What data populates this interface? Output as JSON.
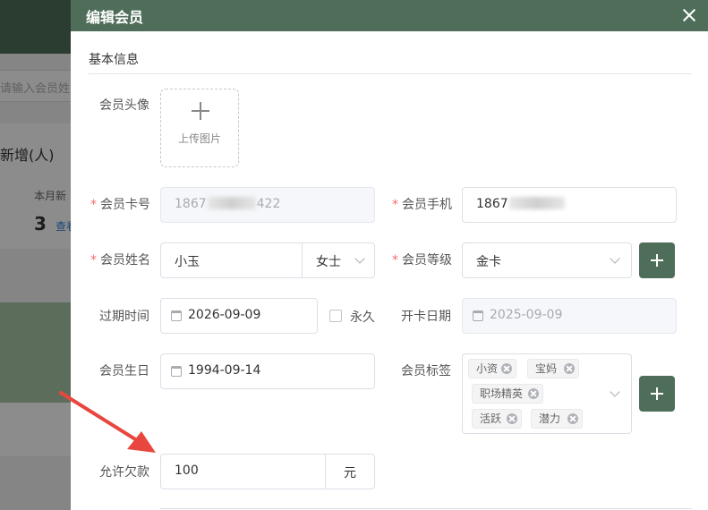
{
  "background": {
    "search_placeholder": "请输入会员姓名",
    "stat_title": "新增(人)",
    "stat_sub": "本月新",
    "stat_value": "3",
    "stat_link": "查看"
  },
  "drawer": {
    "title": "编辑会员",
    "section_title": "基本信息"
  },
  "form": {
    "avatar": {
      "label": "会员头像",
      "upload_text": "上传图片"
    },
    "card_no": {
      "label": "会员卡号",
      "prefix": "1867",
      "suffix": "422"
    },
    "phone": {
      "label": "会员手机",
      "prefix": "1867"
    },
    "name": {
      "label": "会员姓名",
      "value": "小玉",
      "gender": "女士"
    },
    "level": {
      "label": "会员等级",
      "value": "金卡"
    },
    "expire": {
      "label": "过期时间",
      "value": "2026-09-09",
      "forever_label": "永久"
    },
    "open_date": {
      "label": "开卡日期",
      "value": "2025-09-09"
    },
    "birthday": {
      "label": "会员生日",
      "value": "1994-09-14"
    },
    "tags": {
      "label": "会员标签",
      "items": [
        "小资",
        "宝妈",
        "职场精英",
        "活跃",
        "潜力"
      ]
    },
    "credit": {
      "label": "允许欠款",
      "value": "100",
      "unit": "元"
    }
  },
  "colors": {
    "accent": "#4f6e5a",
    "required": "#f56c6c",
    "arrow": "#e8473f"
  }
}
